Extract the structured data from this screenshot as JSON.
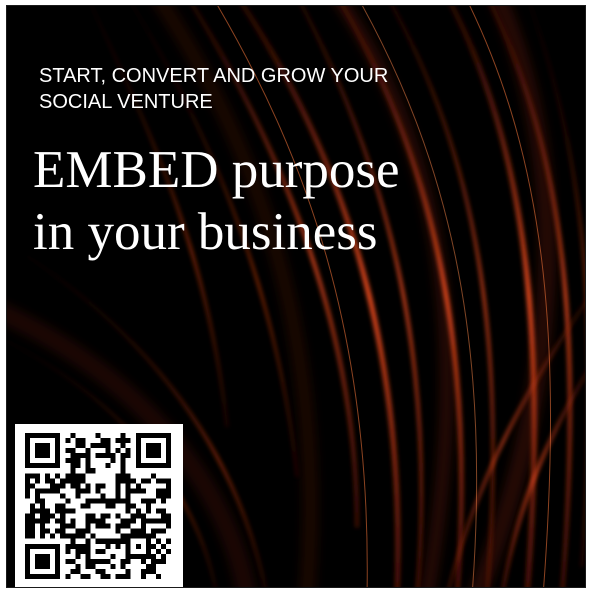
{
  "poster": {
    "subtitle_line1": "START, CONVERT AND GROW YOUR",
    "subtitle_line2": "SOCIAL VENTURE",
    "headline_line1": "EMBED purpose",
    "headline_line2": "in your business",
    "qr_icon": "qr-code-icon",
    "colors": {
      "background": "#000000",
      "accent": "#d9451c",
      "text": "#ffffff"
    }
  }
}
